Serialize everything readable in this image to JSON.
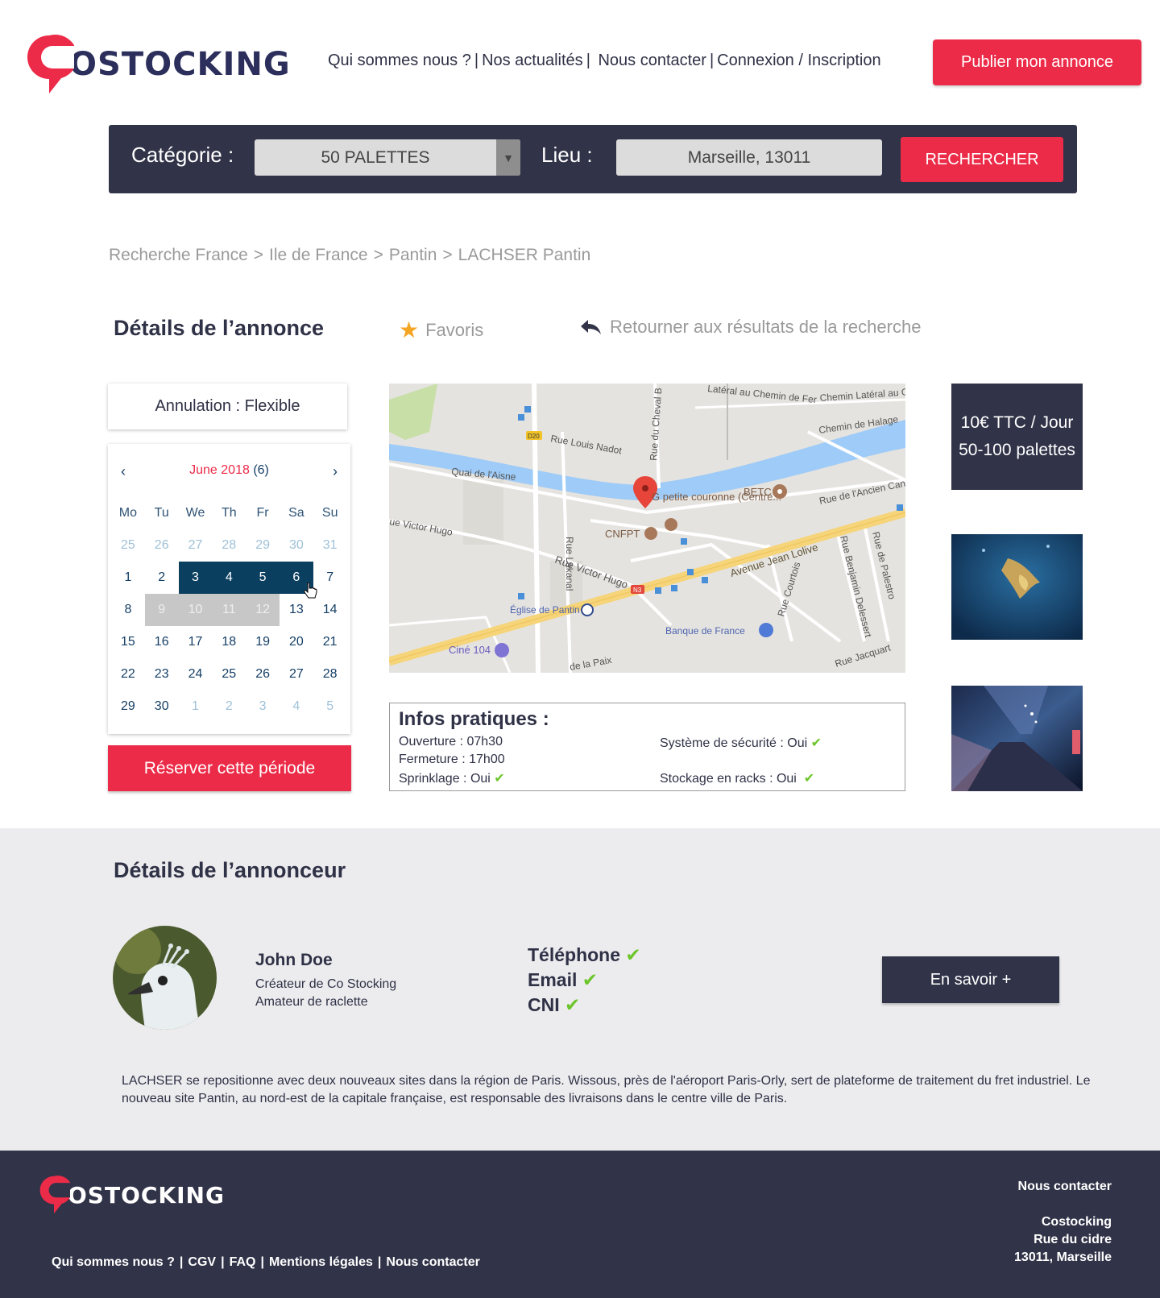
{
  "brand": {
    "name": "OSTOCKING",
    "accent": "#ec2b48",
    "dark": "#313348"
  },
  "nav": {
    "items": [
      "Qui sommes nous ?",
      "Nos actualités",
      "Nous contacter",
      "Connexion / Inscription"
    ],
    "publish_label": "Publier mon annonce"
  },
  "search": {
    "category_label": "Catégorie :",
    "category_value": "50 PALETTES",
    "place_label": "Lieu :",
    "place_value": "Marseille, 13011",
    "submit_label": "RECHERCHER"
  },
  "breadcrumb": [
    "Recherche France",
    "Ile de France",
    "Pantin",
    "LACHSER Pantin"
  ],
  "listing": {
    "title": "Détails de l’annonce",
    "favorite_label": "Favoris",
    "back_label": "Retourner aux résultats de la recherche",
    "cancellation": "Annulation : Flexible",
    "reserve_label": "Réserver cette période",
    "price_line1": "10€  TTC / Jour",
    "price_line2": "50-100 palettes"
  },
  "calendar": {
    "month": "June 2018",
    "count": "(6)",
    "weekdays": [
      "Mo",
      "Tu",
      "We",
      "Th",
      "Fr",
      "Sa",
      "Su"
    ],
    "weeks": [
      [
        "25",
        "26",
        "27",
        "28",
        "29",
        "30",
        "31"
      ],
      [
        "1",
        "2",
        "3",
        "4",
        "5",
        "6",
        "7"
      ],
      [
        "8",
        "9",
        "10",
        "11",
        "12",
        "13",
        "14"
      ],
      [
        "15",
        "16",
        "17",
        "18",
        "19",
        "20",
        "21"
      ],
      [
        "22",
        "23",
        "24",
        "25",
        "26",
        "27",
        "28"
      ],
      [
        "29",
        "30",
        "1",
        "2",
        "3",
        "4",
        "5"
      ]
    ]
  },
  "map": {
    "labels": [
      "Rue Louis Nadot",
      "Quai de l'Aisne",
      "Rue du Cheval B",
      "Chemin Latéral au C",
      "Chemin de Halage",
      "Latéral au Chemin de Fer",
      "Rue de l'Ancien Canal",
      "G petite couronne (Centre...",
      "BETC",
      "CNFPT",
      "Rue Lakanal",
      "Rue Victor Hugo",
      "ue Victor Hugo",
      "Avenue Jean Lolive",
      "Rue Courtois",
      "Rue Benjamin Delessert",
      "Rue de Palestro",
      "Église de Pantin",
      "Banque de France",
      "Ciné 104",
      "Rue Jacquart",
      "de la Paix",
      "D20",
      "N3"
    ]
  },
  "infos": {
    "title": "Infos pratiques :",
    "opening": "Ouverture : 07h30",
    "closing": "Fermeture : 17h00",
    "sprinkler": "Sprinklage : Oui",
    "security": "Système de sécurité : Oui",
    "racks": "Stockage en racks : Oui",
    "check": "✔"
  },
  "announcer": {
    "title": "Détails de l’annonceur",
    "name": "John Doe",
    "role": "Créateur de Co Stocking",
    "hobby": "Amateur de raclette",
    "verifications": [
      "Téléphone",
      "Email",
      "CNI"
    ],
    "more_label": "En savoir +",
    "description": "LACHSER se repositionne avec deux nouveaux sites dans la région de Paris. Wissous, près de l'aéroport Paris-Orly, sert de plateforme de traitement du fret industriel. Le nouveau site Pantin, au nord-est de la capitale française, est responsable des livraisons dans le centre ville de Paris."
  },
  "footer": {
    "links": [
      "Qui sommes nous ?",
      "CGV",
      "FAQ",
      "Mentions légales",
      "Nous contacter"
    ],
    "contact_title": "Nous contacter",
    "company": "Costocking",
    "street": "Rue du cidre",
    "city": "13011, Marseille"
  }
}
